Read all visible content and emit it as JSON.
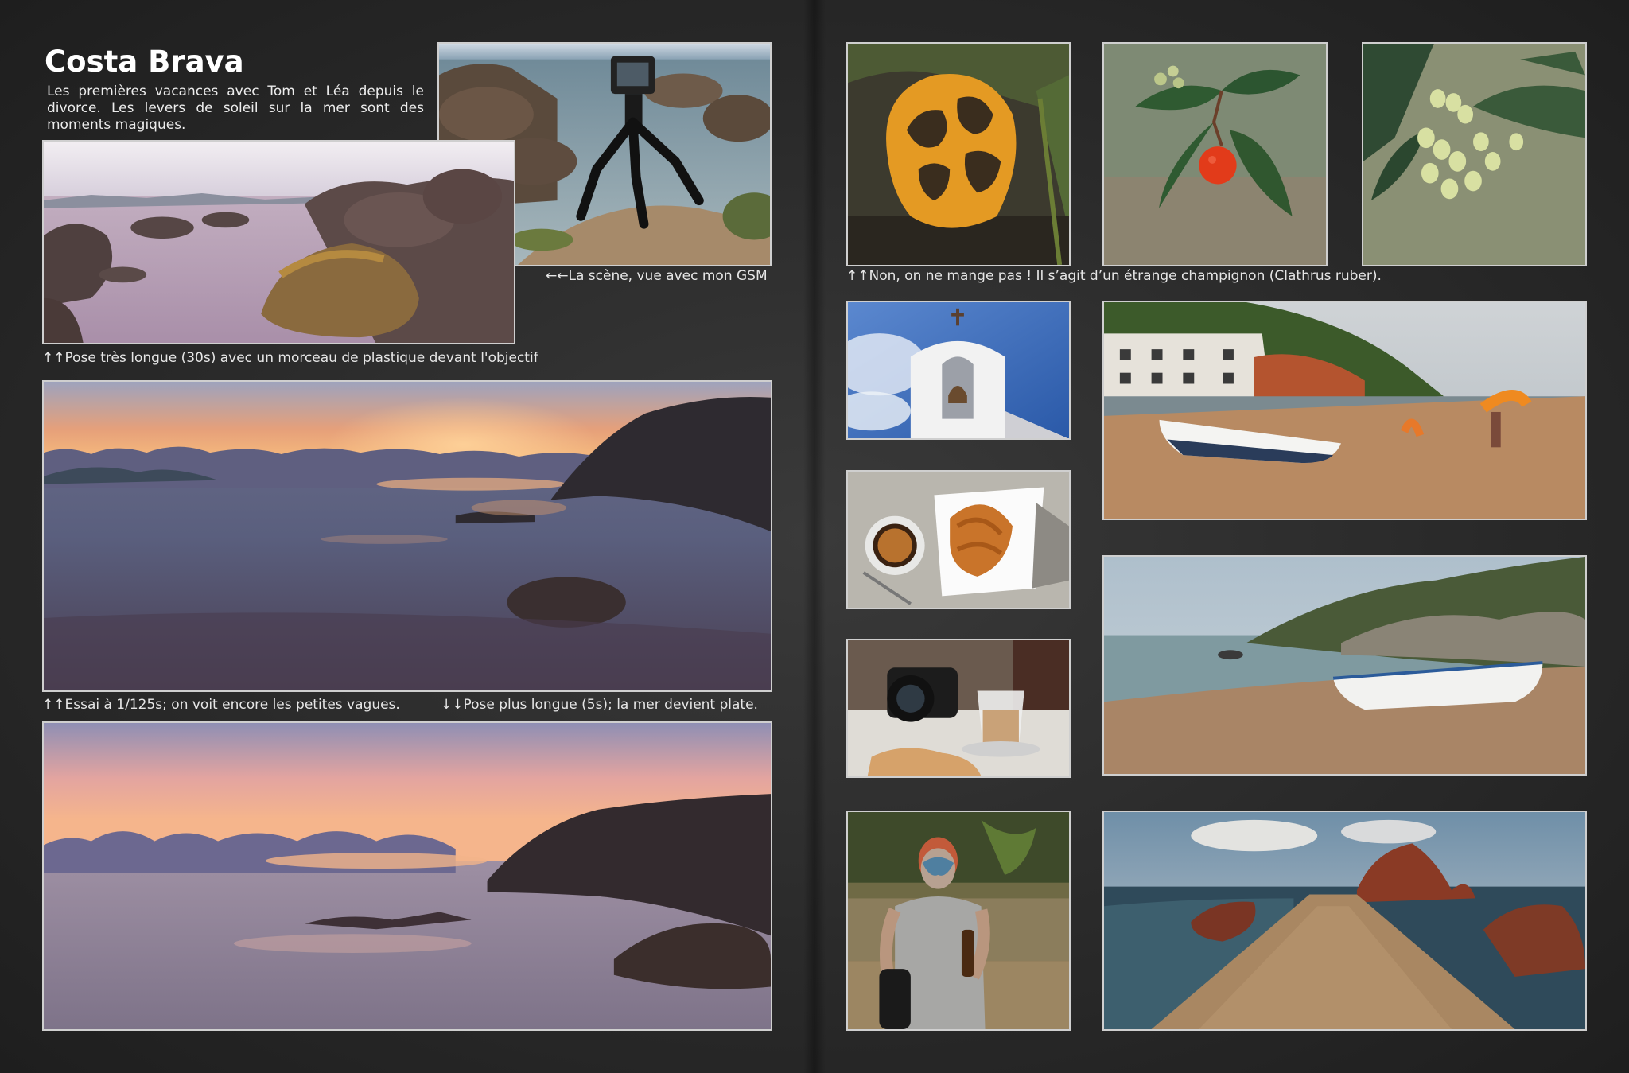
{
  "title": "Costa Brava",
  "intro": "Les premières vacances avec Tom et Léa depuis le divorce. Les levers de soleil sur la mer sont des moments magiques.",
  "captions": {
    "tripod_scene": "←←La scène, vue avec mon GSM",
    "long_exposure": "↑↑Pose très longue (30s) avec un morceau de plastique devant l'objectif",
    "fast_shutter": "↑↑Essai à 1/125s; on voit encore les petites vagues.",
    "slow_shutter": "↓↓Pose plus longue (5s); la mer devient plate.",
    "mushroom": "↑↑Non, on ne mange pas ! Il s’agit d’un étrange champignon (Clathrus ruber)."
  },
  "colors": {
    "background": "#2a2a2a",
    "frame": "#cfcfcf",
    "text": "#ffffff"
  }
}
